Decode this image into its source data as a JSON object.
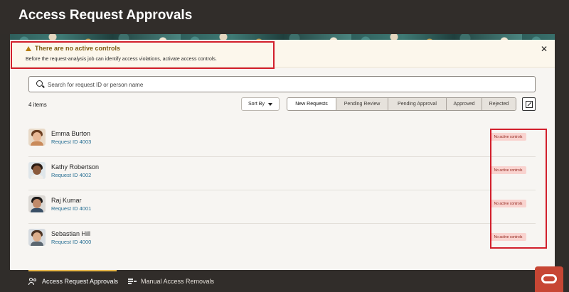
{
  "app": {
    "title": "Access Request Approvals"
  },
  "alert": {
    "title": "There are no active controls",
    "message": "Before the request-analysis job can identify access violations, activate access controls.",
    "close_label": "✕"
  },
  "search": {
    "placeholder": "Search for request ID or person name",
    "value": ""
  },
  "list_header": {
    "count_label": "4 items",
    "sort_label": "Sort By"
  },
  "filters": [
    {
      "label": "New Requests",
      "active": true
    },
    {
      "label": "Pending Review",
      "active": false
    },
    {
      "label": "Pending Approval",
      "active": false
    },
    {
      "label": "Approved",
      "active": false
    },
    {
      "label": "Rejected",
      "active": false
    }
  ],
  "requests": [
    {
      "name": "Emma Burton",
      "request_id": "Request ID 4003",
      "status": "No active controls"
    },
    {
      "name": "Kathy Robertson",
      "request_id": "Request ID 4002",
      "status": "No active controls"
    },
    {
      "name": "Raj Kumar",
      "request_id": "Request ID 4001",
      "status": "No active controls"
    },
    {
      "name": "Sebastian Hill",
      "request_id": "Request ID 4000",
      "status": "No active controls"
    }
  ],
  "bottom_nav": [
    {
      "label": "Access Request Approvals",
      "icon": "people-icon",
      "active": true
    },
    {
      "label": "Manual Access Removals",
      "icon": "list-minus-icon",
      "active": false
    }
  ],
  "colors": {
    "header": "#312d2a",
    "accent": "#e8b84a",
    "highlight": "#d21f2c",
    "badge_bg": "#f9d3cf",
    "link": "#266e93",
    "brand": "#c74634"
  }
}
